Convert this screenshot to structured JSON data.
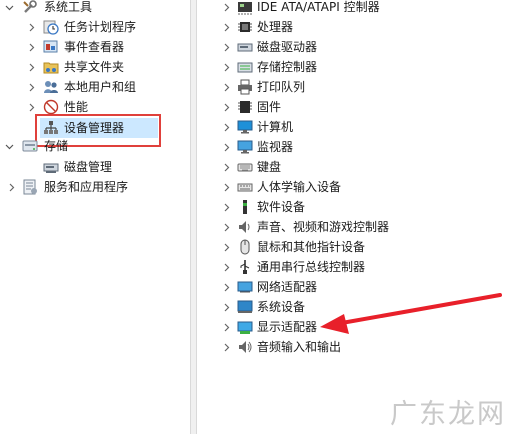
{
  "left_tree": {
    "system_tools": "系统工具",
    "task_scheduler": "任务计划程序",
    "event_viewer": "事件查看器",
    "shared_folders": "共享文件夹",
    "local_users_groups": "本地用户和组",
    "performance": "性能",
    "device_manager": "设备管理器",
    "storage": "存储",
    "disk_management": "磁盘管理",
    "services_apps": "服务和应用程序"
  },
  "devices": [
    {
      "label": "IDE ATA/ATAPI 控制器",
      "icon": "ide-controller-icon"
    },
    {
      "label": "处理器",
      "icon": "processor-icon"
    },
    {
      "label": "磁盘驱动器",
      "icon": "disk-drive-icon"
    },
    {
      "label": "存储控制器",
      "icon": "storage-controller-icon"
    },
    {
      "label": "打印队列",
      "icon": "printer-icon"
    },
    {
      "label": "固件",
      "icon": "firmware-icon"
    },
    {
      "label": "计算机",
      "icon": "computer-icon"
    },
    {
      "label": "监视器",
      "icon": "monitor-icon"
    },
    {
      "label": "键盘",
      "icon": "keyboard-icon"
    },
    {
      "label": "人体学输入设备",
      "icon": "hid-icon"
    },
    {
      "label": "软件设备",
      "icon": "software-device-icon"
    },
    {
      "label": "声音、视频和游戏控制器",
      "icon": "audio-icon"
    },
    {
      "label": "鼠标和其他指针设备",
      "icon": "mouse-icon"
    },
    {
      "label": "通用串行总线控制器",
      "icon": "usb-icon"
    },
    {
      "label": "网络适配器",
      "icon": "network-adapter-icon"
    },
    {
      "label": "系统设备",
      "icon": "system-device-icon"
    },
    {
      "label": "显示适配器",
      "icon": "display-adapter-icon"
    },
    {
      "label": "音频输入和输出",
      "icon": "audio-io-icon"
    }
  ],
  "watermark": "广东龙网",
  "colors": {
    "highlight_border": "#e0403b",
    "selection": "#cce8ff",
    "arrow": "#e8202a"
  }
}
